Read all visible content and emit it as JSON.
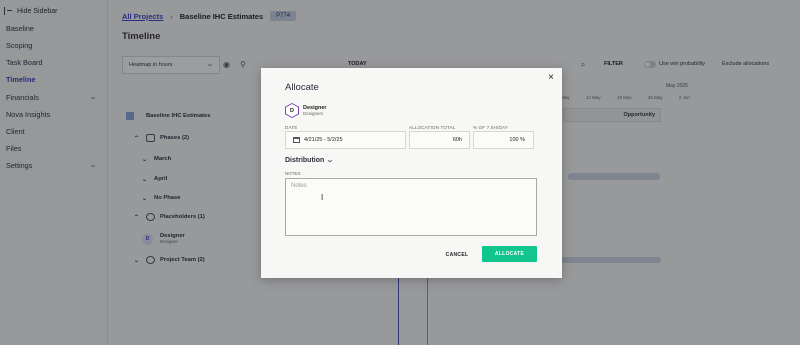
{
  "sidebar": {
    "hide_label": "Hide Sidebar",
    "items": [
      {
        "label": "Baseline"
      },
      {
        "label": "Scoping"
      },
      {
        "label": "Task Board"
      },
      {
        "label": "Timeline"
      },
      {
        "label": "Financials"
      },
      {
        "label": "Nova Insights"
      },
      {
        "label": "Client"
      },
      {
        "label": "Files"
      },
      {
        "label": "Settings"
      }
    ]
  },
  "breadcrumb": {
    "link": "All Projects",
    "current": "Baseline IHC Estimates",
    "badge": "P774"
  },
  "page_title": "Timeline",
  "toolbar": {
    "view_select": "Heatmap in hours",
    "today": "TODAY",
    "filter": "FILTER",
    "win_probability": "Use win probability",
    "exclude": "Exclude allocations"
  },
  "timeline": {
    "month": "May 2025",
    "dates": [
      "28 Apr",
      "5 May",
      "12 May",
      "19 May",
      "26 May",
      "2 Jun"
    ],
    "opportunity": "Opportunity"
  },
  "tree": {
    "project": "Baseline IHC Estimates",
    "phases": "Phases (2)",
    "march": "March",
    "april": "April",
    "no_phase": "No Phase",
    "placeholders": "Placeholders (1)",
    "designer_initial": "D",
    "designer_name": "Designer",
    "designer_sub": "Designer",
    "project_team": "Project Team (2)"
  },
  "modal": {
    "title": "Allocate",
    "close": "×",
    "role_initial": "D",
    "role_name": "Designer",
    "role_sub": "Designers",
    "date_label": "DATE",
    "date_value": "4/21/25 - 5/2/25",
    "total_label": "ALLOCATION TOTAL",
    "total_value": "60h",
    "pct_label": "% OF 7.5H/DAY",
    "pct_value": "100 %",
    "distribution": "Distribution",
    "notes_label": "NOTES",
    "notes_placeholder": "Notes",
    "cancel": "CANCEL",
    "allocate": "ALLOCATE"
  }
}
